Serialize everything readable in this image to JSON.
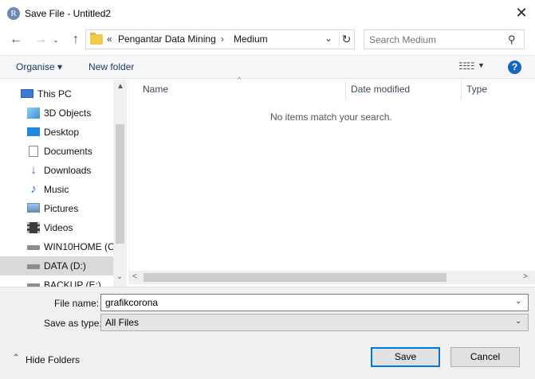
{
  "window": {
    "title": "Save File - Untitled2",
    "app_icon_letter": "R",
    "close_glyph": "✕"
  },
  "nav": {
    "back_glyph": "←",
    "forward_glyph": "→",
    "recent_glyph": "⌄",
    "up_glyph": "↑",
    "address": {
      "overflow": "«",
      "crumbs": [
        "Pengantar Data Mining",
        "Medium"
      ],
      "separator": "›",
      "dropdown_glyph": "⌄",
      "refresh_glyph": "↻"
    },
    "search": {
      "placeholder": "Search Medium",
      "icon": "search-icon",
      "icon_glyph": "⚲"
    }
  },
  "toolbar": {
    "organise_label": "Organise ▾",
    "new_folder_label": "New folder",
    "view_glyph": "☷☷",
    "view_dropdown_glyph": "▼",
    "help_glyph": "?"
  },
  "sidebar": {
    "items": [
      {
        "label": "This PC",
        "icon": "this-pc-icon",
        "selected": false
      },
      {
        "label": "3D Objects",
        "icon": "3d-objects-icon",
        "selected": false
      },
      {
        "label": "Desktop",
        "icon": "desktop-icon",
        "selected": false
      },
      {
        "label": "Documents",
        "icon": "documents-icon",
        "selected": false
      },
      {
        "label": "Downloads",
        "icon": "downloads-icon",
        "selected": false
      },
      {
        "label": "Music",
        "icon": "music-icon",
        "selected": false
      },
      {
        "label": "Pictures",
        "icon": "pictures-icon",
        "selected": false
      },
      {
        "label": "Videos",
        "icon": "videos-icon",
        "selected": false
      },
      {
        "label": "WIN10HOME (C:",
        "icon": "drive-icon",
        "selected": false
      },
      {
        "label": "DATA (D:)",
        "icon": "drive-icon",
        "selected": true
      },
      {
        "label": "BACKUP (E:)",
        "icon": "drive-icon",
        "selected": false
      }
    ],
    "scroll_up_glyph": "▲",
    "scroll_down_glyph": "⌄"
  },
  "file_list": {
    "columns": [
      "Name",
      "Date modified",
      "Type"
    ],
    "sort_glyph": "^",
    "empty_message": "No items match your search.",
    "scroll_left_glyph": "<",
    "scroll_right_glyph": ">"
  },
  "form": {
    "file_name_label": "File name:",
    "file_name_value": "grafikcorona",
    "save_type_label": "Save as type:",
    "save_type_value": "All Files",
    "dropdown_glyph": "⌄"
  },
  "footer": {
    "hide_folders_glyph": "⌃",
    "hide_folders_label": "Hide Folders",
    "save_label": "Save",
    "cancel_label": "Cancel"
  },
  "colors": {
    "accent": "#0078d7",
    "help_blue": "#1565c0",
    "folder_yellow": "#f3c94c",
    "selected_row": "#d9d9d9"
  }
}
